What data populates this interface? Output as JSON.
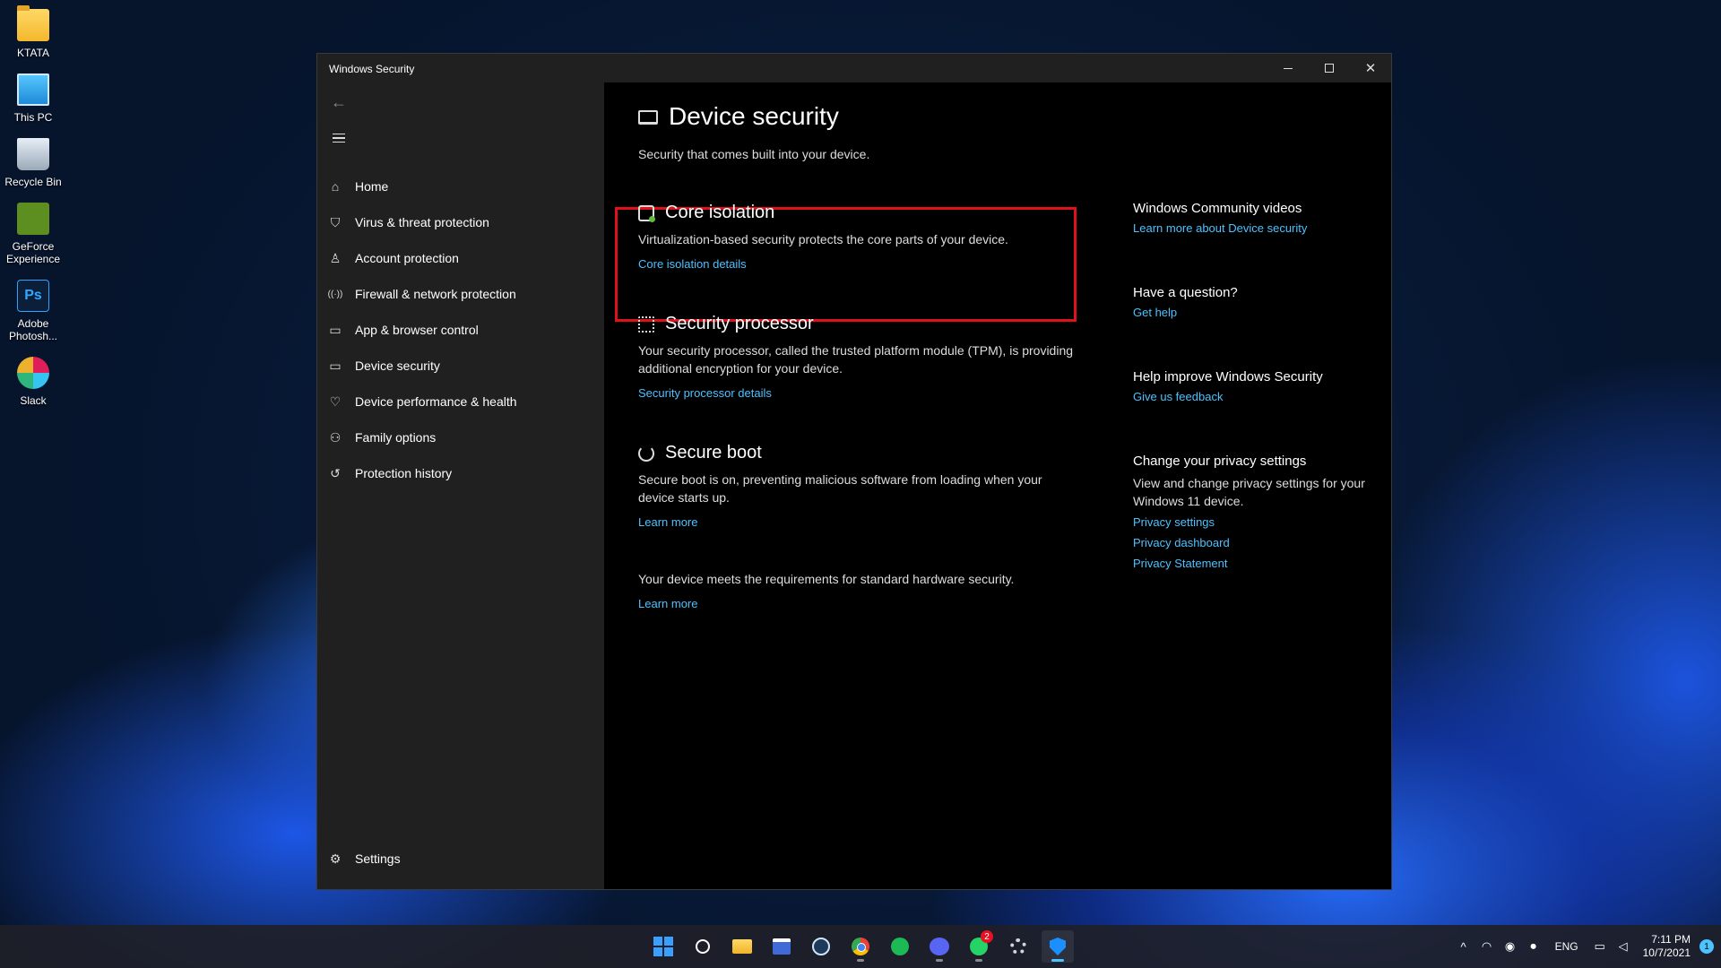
{
  "desktop": {
    "icons": [
      {
        "label": "KTATA",
        "icon": "folder-icon"
      },
      {
        "label": "This PC",
        "icon": "computer-icon"
      },
      {
        "label": "Recycle Bin",
        "icon": "recycle-bin-icon"
      },
      {
        "label": "GeForce Experience",
        "icon": "geforce-icon"
      },
      {
        "label": "Adobe Photosh...",
        "icon": "photoshop-icon"
      },
      {
        "label": "Slack",
        "icon": "slack-icon"
      }
    ]
  },
  "window": {
    "title": "Windows Security",
    "controls": {
      "minimize": "─",
      "maximize": "☐",
      "close": "✕"
    }
  },
  "sidebar": {
    "back_icon": "←",
    "items": [
      {
        "label": "Home",
        "icon": "⌂"
      },
      {
        "label": "Virus & threat protection",
        "icon": "⛉"
      },
      {
        "label": "Account protection",
        "icon": "♙"
      },
      {
        "label": "Firewall & network protection",
        "icon": "((·))"
      },
      {
        "label": "App & browser control",
        "icon": "▭"
      },
      {
        "label": "Device security",
        "icon": "▭"
      },
      {
        "label": "Device performance & health",
        "icon": "♡"
      },
      {
        "label": "Family options",
        "icon": "⚇"
      },
      {
        "label": "Protection history",
        "icon": "↺"
      }
    ],
    "settings_label": "Settings",
    "settings_icon": "⚙"
  },
  "main": {
    "title": "Device security",
    "subtitle": "Security that comes built into your device.",
    "sections": [
      {
        "title": "Core isolation",
        "description": "Virtualization-based security protects the core parts of your device.",
        "link": "Core isolation details"
      },
      {
        "title": "Security processor",
        "description": "Your security processor, called the trusted platform module (TPM), is providing additional encryption for your device.",
        "link": "Security processor details"
      },
      {
        "title": "Secure boot",
        "description": "Secure boot is on, preventing malicious software from loading when your device starts up.",
        "link": "Learn more"
      }
    ],
    "footer_text": "Your device meets the requirements for standard hardware security.",
    "footer_link": "Learn more"
  },
  "right_panel": {
    "community": {
      "title": "Windows Community videos",
      "link": "Learn more about Device security"
    },
    "question": {
      "title": "Have a question?",
      "link": "Get help"
    },
    "improve": {
      "title": "Help improve Windows Security",
      "link": "Give us feedback"
    },
    "privacy": {
      "title": "Change your privacy settings",
      "description": "View and change privacy settings for your Windows 11 device.",
      "links": [
        "Privacy settings",
        "Privacy dashboard",
        "Privacy Statement"
      ]
    }
  },
  "taskbar": {
    "apps": [
      "start-icon",
      "search-icon",
      "file-explorer-icon",
      "microsoft-store-icon",
      "steam-icon",
      "chrome-icon",
      "spotify-icon",
      "discord-icon",
      "whatsapp-icon",
      "settings-icon",
      "windows-security-icon"
    ],
    "whatsapp_badge": "2",
    "tray": {
      "chevron": "^",
      "language": "ENG",
      "time": "7:11 PM",
      "date": "10/7/2021",
      "notification_count": "1"
    }
  },
  "colors": {
    "accent": "#4cc2ff",
    "highlight_box": "#e0111b",
    "sidebar_bg": "#202020",
    "content_bg": "#000000"
  }
}
